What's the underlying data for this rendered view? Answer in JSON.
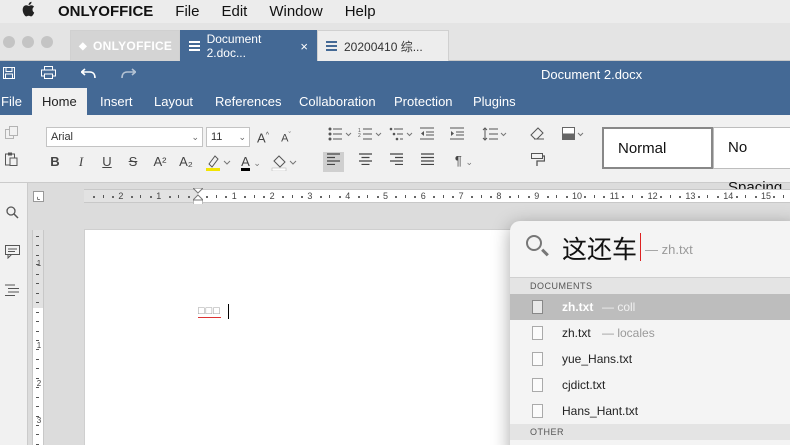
{
  "menubar": {
    "apple": "",
    "app_name": "ONLYOFFICE",
    "items": [
      "File",
      "Edit",
      "Window",
      "Help"
    ]
  },
  "tabs": {
    "home_label": "ONLYOFFICE",
    "active_label": "Document 2.doc...",
    "active_close": "×",
    "other_label": "20200410  综..."
  },
  "titlebar": {
    "document_title": "Document 2.docx"
  },
  "ribbon_tabs": [
    "File",
    "Home",
    "Insert",
    "Layout",
    "References",
    "Collaboration",
    "Protection",
    "Plugins"
  ],
  "toolbar": {
    "font_name": "Arial",
    "font_size": "11",
    "bold": "B",
    "italic": "I",
    "underline": "U",
    "strike": "S",
    "superscript": "A²",
    "subscript": "A₂",
    "font_color": "A",
    "pilcrow": "¶",
    "grow": "A",
    "shrink": "A",
    "styles": [
      "Normal",
      "No Spacing"
    ]
  },
  "ruler": {
    "h_numbers": [
      "2",
      "1",
      "1",
      "2",
      "3",
      "4",
      "5",
      "6",
      "7",
      "8",
      "9",
      "10",
      "11",
      "12",
      "13",
      "14",
      "15"
    ],
    "v_numbers": [
      "1",
      "1",
      "2",
      "3"
    ]
  },
  "document": {
    "text": "□□□"
  },
  "spotlight": {
    "query": "这还车",
    "query_hint": "— zh.txt",
    "section_documents": "DOCUMENTS",
    "section_other": "OTHER",
    "results": [
      {
        "name": "zh.txt",
        "hint": "— coll",
        "selected": true
      },
      {
        "name": "zh.txt",
        "hint": "— locales",
        "selected": false
      },
      {
        "name": "yue_Hans.txt",
        "hint": "",
        "selected": false
      },
      {
        "name": "cjdict.txt",
        "hint": "",
        "selected": false
      },
      {
        "name": "Hans_Hant.txt",
        "hint": "",
        "selected": false
      }
    ]
  },
  "colors": {
    "brand_blue": "#446995",
    "font_color_bar": "#000000",
    "highlight_bar": "#f2e400",
    "spell_underline": "#d33333"
  }
}
